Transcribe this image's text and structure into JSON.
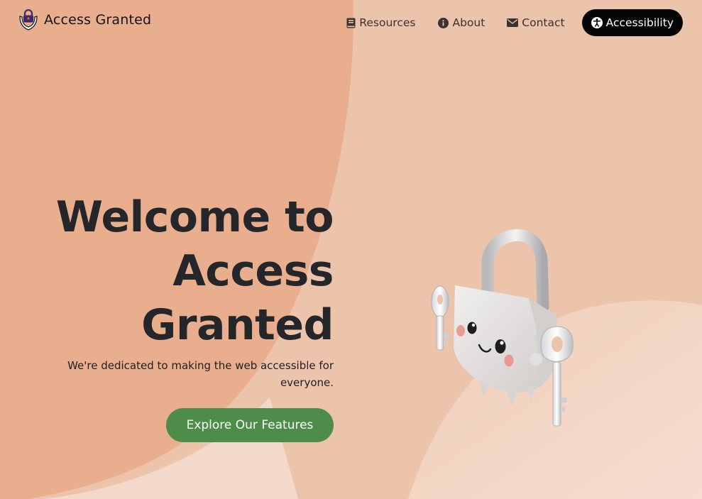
{
  "brand": {
    "name": "Access Granted",
    "logo_icon": "hands-lock-icon"
  },
  "nav": {
    "links": [
      {
        "label": "Resources",
        "icon": "book-icon"
      },
      {
        "label": "About",
        "icon": "info-icon"
      },
      {
        "label": "Contact",
        "icon": "envelope-icon"
      }
    ],
    "accessibility": {
      "label": "Accessibility",
      "icon": "accessibility-icon"
    }
  },
  "hero": {
    "title_lines": [
      "Welcome to",
      "Access",
      "Granted"
    ],
    "subtitle": "We're dedicated to making the web accessible for everyone.",
    "cta_label": "Explore Our Features"
  },
  "colors": {
    "background": "#ecc3ab",
    "blob": "#e8ae8e",
    "cta": "#4e8c4a",
    "accessibility_button": "#050505",
    "heading": "#24262a"
  }
}
